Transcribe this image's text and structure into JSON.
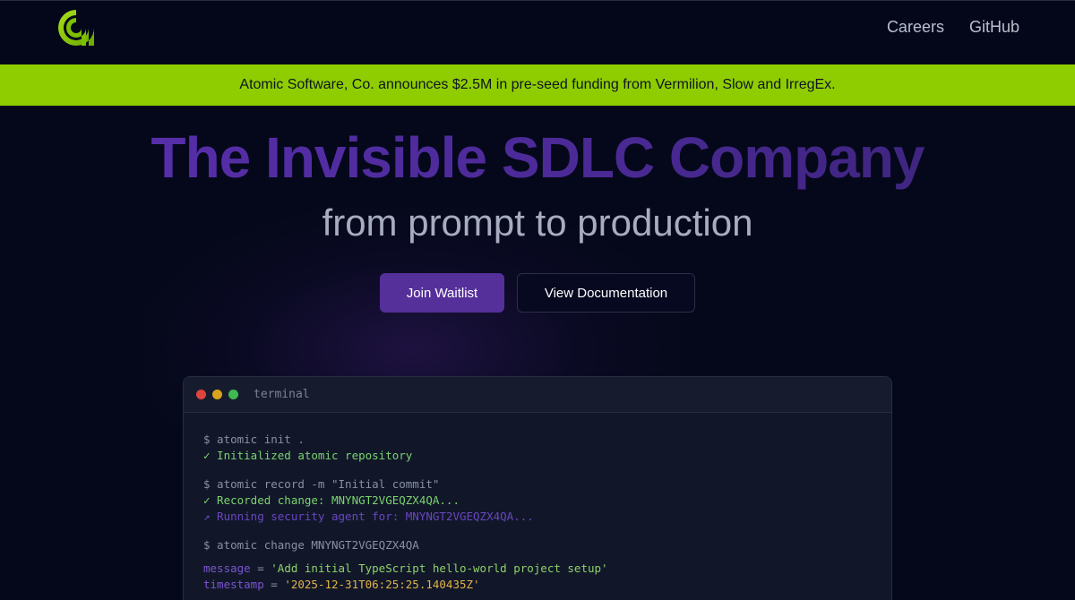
{
  "nav": {
    "logo_name": "atomic-logo",
    "links": [
      "Careers",
      "GitHub"
    ]
  },
  "banner": {
    "text": "Atomic Software, Co. announces $2.5M in pre-seed funding from Vermilion, Slow and IrregEx."
  },
  "hero": {
    "title": "The Invisible SDLC Company",
    "subtitle": "from prompt to production",
    "primary_button": "Join Waitlist",
    "secondary_button": "View Documentation"
  },
  "terminal": {
    "title": "terminal",
    "lines": {
      "cmd1": "$ atomic init .",
      "out1": "✓ Initialized atomic repository",
      "cmd2": "$ atomic record -m \"Initial commit\"",
      "out2": "✓ Recorded change: MNYNGT2VGEQZX4QA...",
      "out3": "↗ Running security agent for: MNYNGT2VGEQZX4QA...",
      "cmd3": "$ atomic change MNYNGT2VGEQZX4QA",
      "msg_key": "message",
      "msg_val": "'Add initial TypeScript hello-world project setup'",
      "ts_key": "timestamp",
      "ts_val": "'2025-12-31T06:25:25.140435Z'",
      "eq": " = "
    }
  },
  "colors": {
    "banner": "#8fcd00",
    "accent": "#55309a",
    "background": "#05081a"
  }
}
